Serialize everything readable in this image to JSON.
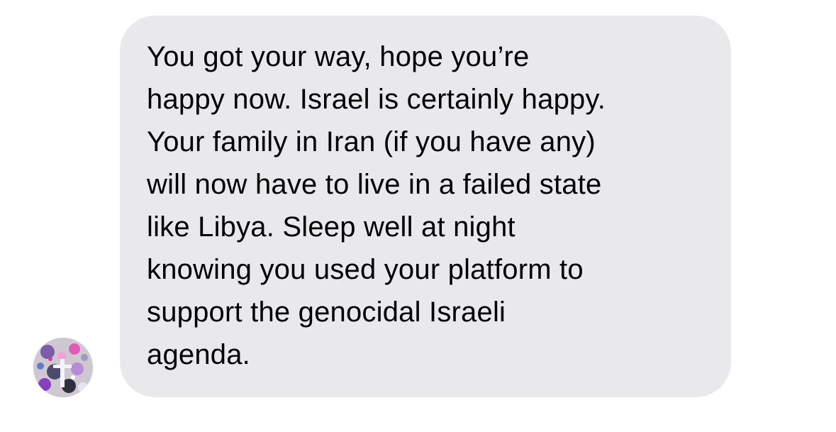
{
  "message": {
    "lines": [
      "You got your way, hope you’re",
      "happy now. Israel is certainly happy.",
      "Your family in Iran (if you have any)",
      "will now have to live in a failed state",
      "like Libya. Sleep well at night",
      "knowing you used your platform to",
      "support the genocidal Israeli",
      "agenda."
    ]
  },
  "colors": {
    "bubble_background": "#e9e9eb",
    "text": "#000000",
    "page_background": "#ffffff"
  },
  "icons": {
    "avatar": "sender-avatar"
  }
}
